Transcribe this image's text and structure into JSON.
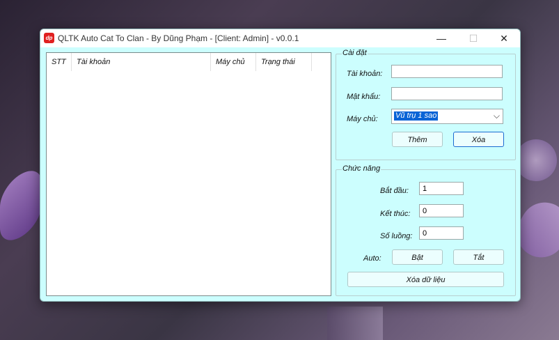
{
  "window": {
    "title": "QLTK Auto Cat To Clan - By Dũng Phạm - [Client: Admin] - v0.0.1",
    "icon_text": "dp",
    "minimize": "—",
    "maximize": "☐",
    "close": "✕"
  },
  "list": {
    "columns": [
      "STT",
      "Tài khoản",
      "Máy chủ",
      "Trạng thái"
    ]
  },
  "settings": {
    "legend": "Cài đặt",
    "account_label": "Tài khoản:",
    "account_value": "",
    "password_label": "Mật khẩu:",
    "password_value": "",
    "server_label": "Máy chủ:",
    "server_value": "Vũ trụ 1 sao",
    "add_button": "Thêm",
    "delete_button": "Xóa"
  },
  "functions": {
    "legend": "Chức năng",
    "start_label": "Bắt đầu:",
    "start_value": "1",
    "end_label": "Kết thúc:",
    "end_value": "0",
    "threads_label": "Số luồng:",
    "threads_value": "0",
    "auto_label": "Auto:",
    "on_button": "Bật",
    "off_button": "Tắt",
    "clear_data_button": "Xóa dữ liệu"
  }
}
